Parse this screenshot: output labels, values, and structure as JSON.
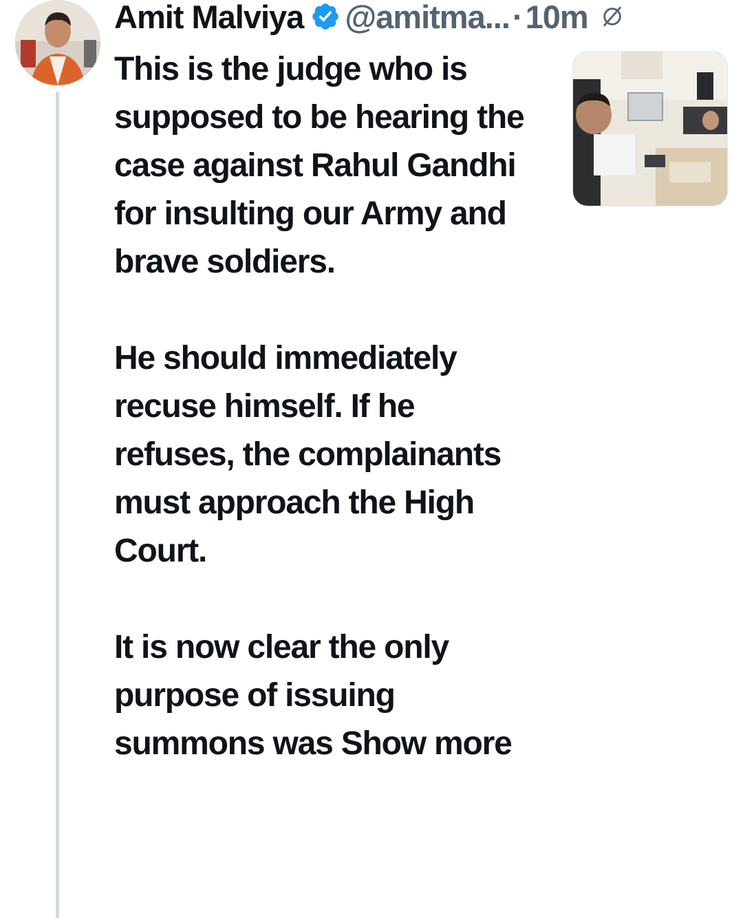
{
  "author": {
    "name": "Amit Malviya",
    "handle": "@amitma...",
    "separator": "·",
    "time": "10m",
    "verified_icon": "verified-badge-icon",
    "grok_icon": "grok-icon"
  },
  "tweet": {
    "paragraphs": [
      "This is the judge who is supposed to be hearing the case against Rahul Gandhi for insulting our Army and brave soldiers.",
      "He should immediately recuse himself. If he refuses, the complainants must approach the High Court.",
      "It is now clear the only purpose of issuing summons was"
    ],
    "show_more": "Show more"
  },
  "colors": {
    "text": "#0f1419",
    "secondary": "#536471",
    "verified": "#1d9bf0",
    "thread_line": "#cfd9de"
  }
}
